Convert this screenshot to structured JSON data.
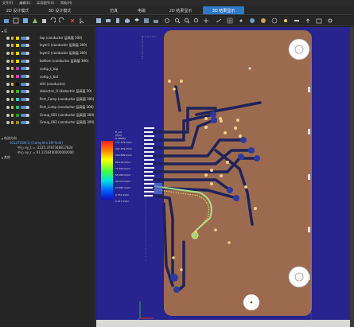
{
  "menu": [
    "文件(F)",
    "编辑(E)",
    "实用程序(U)",
    "帮助(H)"
  ],
  "tabs": [
    {
      "label": "2D 设计模式",
      "active": false
    },
    {
      "label": "3D 设计模式",
      "active": false
    },
    {
      "label": "仿真",
      "active": false
    },
    {
      "label": "电磁",
      "active": false
    },
    {
      "label": "2D 结果显示",
      "active": false
    },
    {
      "label": "3D 结果显示",
      "active": true
    }
  ],
  "layers_panel": {
    "title": "层",
    "layers": [
      {
        "name": "top (conductor 层高值 300)",
        "color": "#e8d800"
      },
      {
        "name": "layer1 (conductor 层高值 300)",
        "color": "#e8d800"
      },
      {
        "name": "layer2 (conductor 层高值 300)",
        "color": "#e8d800"
      },
      {
        "name": "bottom (conductor 层高值 300)",
        "color": "#e8d800"
      },
      {
        "name": "comp_t_top",
        "color": "#b040c0"
      },
      {
        "name": "comp_t_bot",
        "color": "#d040d0"
      },
      {
        "name": "drill (conductor)",
        "color": "#111111"
      },
      {
        "name": "dielectric_0 (dielectric 层高值 20)",
        "color": "#2db52d"
      },
      {
        "name": "Port_Comp (conductor 层高值 300)",
        "color": "#2ad0c0"
      },
      {
        "name": "Port_Lump (conductor 层高值 300)",
        "color": "#20c080"
      },
      {
        "name": "Group_001 (conductor 层高值 300)",
        "color": "#1c9c2c"
      },
      {
        "name": "Group_002 (conductor 层高值 300)",
        "color": "#8c8c30"
      }
    ]
  },
  "results_panel": {
    "title": "电流方向",
    "item": "SOLUTION(1) [Complete EM field]",
    "values": [
      "中心 ey_t = -2225.3787348817824",
      "中心 ey_r = 91.1256400000000000"
    ]
  },
  "other_panel": {
    "title": "其他"
  },
  "legend": {
    "title": "E_vol",
    "subtitle1": "(V/m)",
    "subtitle2": "0.50GHz",
    "ticks": [
      "137.379 kV/m",
      "121.379 kV/m",
      "102.569 kV/m",
      "86.149 kV/m",
      "71.553 kV/m",
      "55.993 kV/m",
      "36.373 kV/m",
      "13.051 kV/m",
      "0.551 kV/m",
      "0.017 kV/m"
    ]
  },
  "colors": {
    "board": "#9c6b4f",
    "background": "#28248f",
    "trace": "#1e235a",
    "accent": "#2f79c8"
  }
}
